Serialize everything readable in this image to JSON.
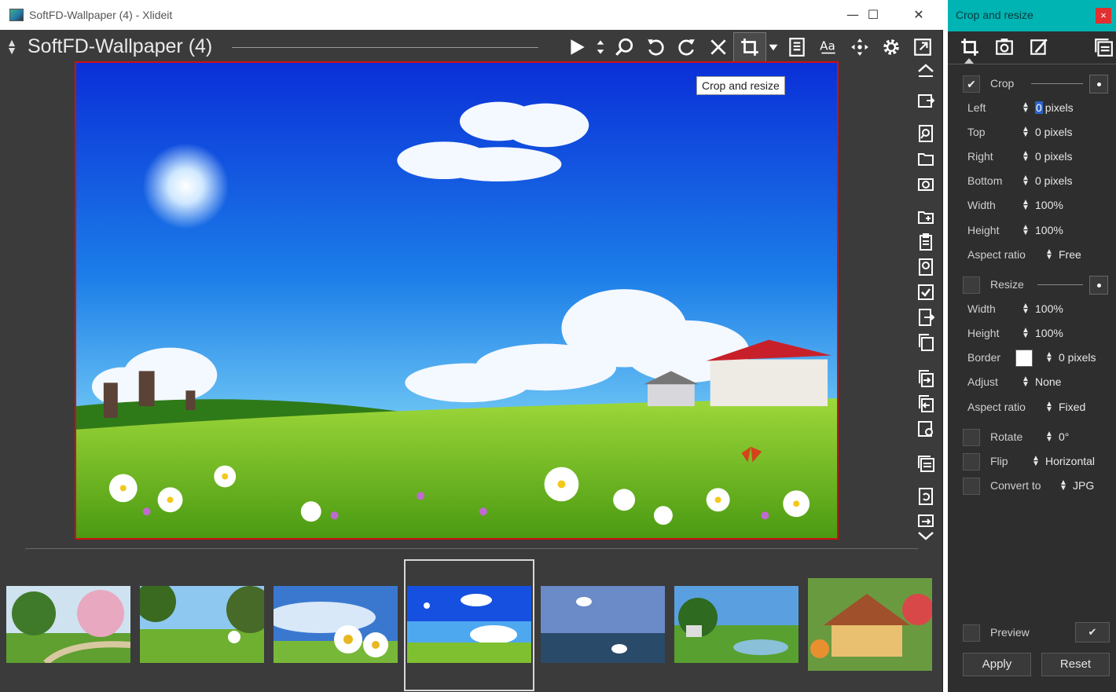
{
  "window": {
    "title": "SoftFD-Wallpaper (4) - Xlideit",
    "minimize_glyph": "—",
    "maximize_glyph": "☐",
    "close_glyph": "✕"
  },
  "viewer": {
    "image_title": "SoftFD-Wallpaper (4)",
    "tooltip": "Crop and resize"
  },
  "toolbar": {
    "icons": [
      "play-icon",
      "sort-arrows-icon",
      "search-icon",
      "rotate-left-icon",
      "rotate-right-icon",
      "close-icon",
      "crop-icon",
      "dropdown-icon",
      "document-icon",
      "text-icon",
      "move-icon",
      "gear-icon",
      "external-link-icon"
    ]
  },
  "thumbnails": {
    "count": 7,
    "selected_index": 3
  },
  "panel": {
    "title": "Crop and resize",
    "close_glyph": "×",
    "crop": {
      "label": "Crop",
      "checked": true,
      "check_glyph": "✔",
      "rows": [
        {
          "label": "Left",
          "value": "0",
          "unit": "pixels"
        },
        {
          "label": "Top",
          "value": "0 pixels"
        },
        {
          "label": "Right",
          "value": "0 pixels"
        },
        {
          "label": "Bottom",
          "value": "0 pixels"
        },
        {
          "label": "Width",
          "value": "100%"
        },
        {
          "label": "Height",
          "value": "100%"
        },
        {
          "label": "Aspect ratio",
          "value": "Free"
        }
      ]
    },
    "resize": {
      "label": "Resize",
      "checked": false,
      "rows": [
        {
          "label": "Width",
          "value": "100%"
        },
        {
          "label": "Height",
          "value": "100%"
        },
        {
          "label": "Border",
          "value": "0 pixels"
        },
        {
          "label": "Adjust",
          "value": "None"
        },
        {
          "label": "Aspect ratio",
          "value": "Fixed"
        }
      ]
    },
    "rotate": {
      "label": "Rotate",
      "value": "0°"
    },
    "flip": {
      "label": "Flip",
      "value": "Horizontal"
    },
    "convert": {
      "label": "Convert to",
      "value": "JPG"
    },
    "preview": {
      "label": "Preview",
      "check_glyph": "✔"
    },
    "apply_label": "Apply",
    "reset_label": "Reset"
  },
  "colors": {
    "panel_header": "#00b4b4",
    "selection_border": "#d01010",
    "app_background": "#3b3b3b"
  }
}
